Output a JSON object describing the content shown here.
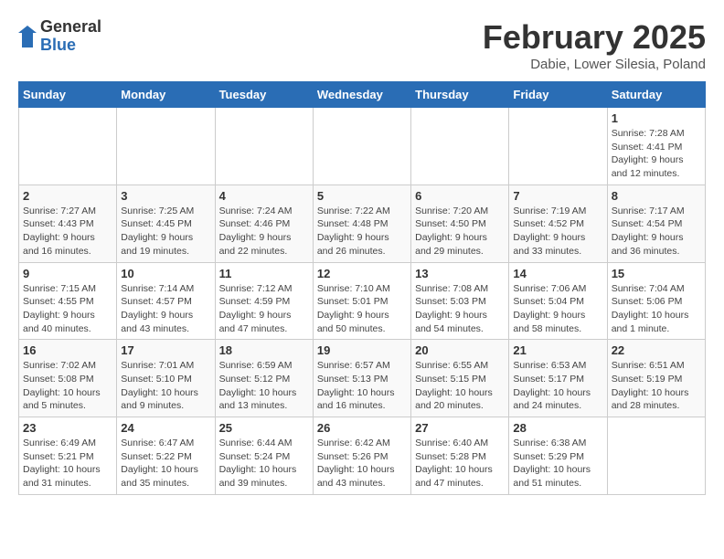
{
  "header": {
    "logo_general": "General",
    "logo_blue": "Blue",
    "month_title": "February 2025",
    "location": "Dabie, Lower Silesia, Poland"
  },
  "weekdays": [
    "Sunday",
    "Monday",
    "Tuesday",
    "Wednesday",
    "Thursday",
    "Friday",
    "Saturday"
  ],
  "weeks": [
    [
      {
        "day": "",
        "info": ""
      },
      {
        "day": "",
        "info": ""
      },
      {
        "day": "",
        "info": ""
      },
      {
        "day": "",
        "info": ""
      },
      {
        "day": "",
        "info": ""
      },
      {
        "day": "",
        "info": ""
      },
      {
        "day": "1",
        "info": "Sunrise: 7:28 AM\nSunset: 4:41 PM\nDaylight: 9 hours and 12 minutes."
      }
    ],
    [
      {
        "day": "2",
        "info": "Sunrise: 7:27 AM\nSunset: 4:43 PM\nDaylight: 9 hours and 16 minutes."
      },
      {
        "day": "3",
        "info": "Sunrise: 7:25 AM\nSunset: 4:45 PM\nDaylight: 9 hours and 19 minutes."
      },
      {
        "day": "4",
        "info": "Sunrise: 7:24 AM\nSunset: 4:46 PM\nDaylight: 9 hours and 22 minutes."
      },
      {
        "day": "5",
        "info": "Sunrise: 7:22 AM\nSunset: 4:48 PM\nDaylight: 9 hours and 26 minutes."
      },
      {
        "day": "6",
        "info": "Sunrise: 7:20 AM\nSunset: 4:50 PM\nDaylight: 9 hours and 29 minutes."
      },
      {
        "day": "7",
        "info": "Sunrise: 7:19 AM\nSunset: 4:52 PM\nDaylight: 9 hours and 33 minutes."
      },
      {
        "day": "8",
        "info": "Sunrise: 7:17 AM\nSunset: 4:54 PM\nDaylight: 9 hours and 36 minutes."
      }
    ],
    [
      {
        "day": "9",
        "info": "Sunrise: 7:15 AM\nSunset: 4:55 PM\nDaylight: 9 hours and 40 minutes."
      },
      {
        "day": "10",
        "info": "Sunrise: 7:14 AM\nSunset: 4:57 PM\nDaylight: 9 hours and 43 minutes."
      },
      {
        "day": "11",
        "info": "Sunrise: 7:12 AM\nSunset: 4:59 PM\nDaylight: 9 hours and 47 minutes."
      },
      {
        "day": "12",
        "info": "Sunrise: 7:10 AM\nSunset: 5:01 PM\nDaylight: 9 hours and 50 minutes."
      },
      {
        "day": "13",
        "info": "Sunrise: 7:08 AM\nSunset: 5:03 PM\nDaylight: 9 hours and 54 minutes."
      },
      {
        "day": "14",
        "info": "Sunrise: 7:06 AM\nSunset: 5:04 PM\nDaylight: 9 hours and 58 minutes."
      },
      {
        "day": "15",
        "info": "Sunrise: 7:04 AM\nSunset: 5:06 PM\nDaylight: 10 hours and 1 minute."
      }
    ],
    [
      {
        "day": "16",
        "info": "Sunrise: 7:02 AM\nSunset: 5:08 PM\nDaylight: 10 hours and 5 minutes."
      },
      {
        "day": "17",
        "info": "Sunrise: 7:01 AM\nSunset: 5:10 PM\nDaylight: 10 hours and 9 minutes."
      },
      {
        "day": "18",
        "info": "Sunrise: 6:59 AM\nSunset: 5:12 PM\nDaylight: 10 hours and 13 minutes."
      },
      {
        "day": "19",
        "info": "Sunrise: 6:57 AM\nSunset: 5:13 PM\nDaylight: 10 hours and 16 minutes."
      },
      {
        "day": "20",
        "info": "Sunrise: 6:55 AM\nSunset: 5:15 PM\nDaylight: 10 hours and 20 minutes."
      },
      {
        "day": "21",
        "info": "Sunrise: 6:53 AM\nSunset: 5:17 PM\nDaylight: 10 hours and 24 minutes."
      },
      {
        "day": "22",
        "info": "Sunrise: 6:51 AM\nSunset: 5:19 PM\nDaylight: 10 hours and 28 minutes."
      }
    ],
    [
      {
        "day": "23",
        "info": "Sunrise: 6:49 AM\nSunset: 5:21 PM\nDaylight: 10 hours and 31 minutes."
      },
      {
        "day": "24",
        "info": "Sunrise: 6:47 AM\nSunset: 5:22 PM\nDaylight: 10 hours and 35 minutes."
      },
      {
        "day": "25",
        "info": "Sunrise: 6:44 AM\nSunset: 5:24 PM\nDaylight: 10 hours and 39 minutes."
      },
      {
        "day": "26",
        "info": "Sunrise: 6:42 AM\nSunset: 5:26 PM\nDaylight: 10 hours and 43 minutes."
      },
      {
        "day": "27",
        "info": "Sunrise: 6:40 AM\nSunset: 5:28 PM\nDaylight: 10 hours and 47 minutes."
      },
      {
        "day": "28",
        "info": "Sunrise: 6:38 AM\nSunset: 5:29 PM\nDaylight: 10 hours and 51 minutes."
      },
      {
        "day": "",
        "info": ""
      }
    ]
  ]
}
